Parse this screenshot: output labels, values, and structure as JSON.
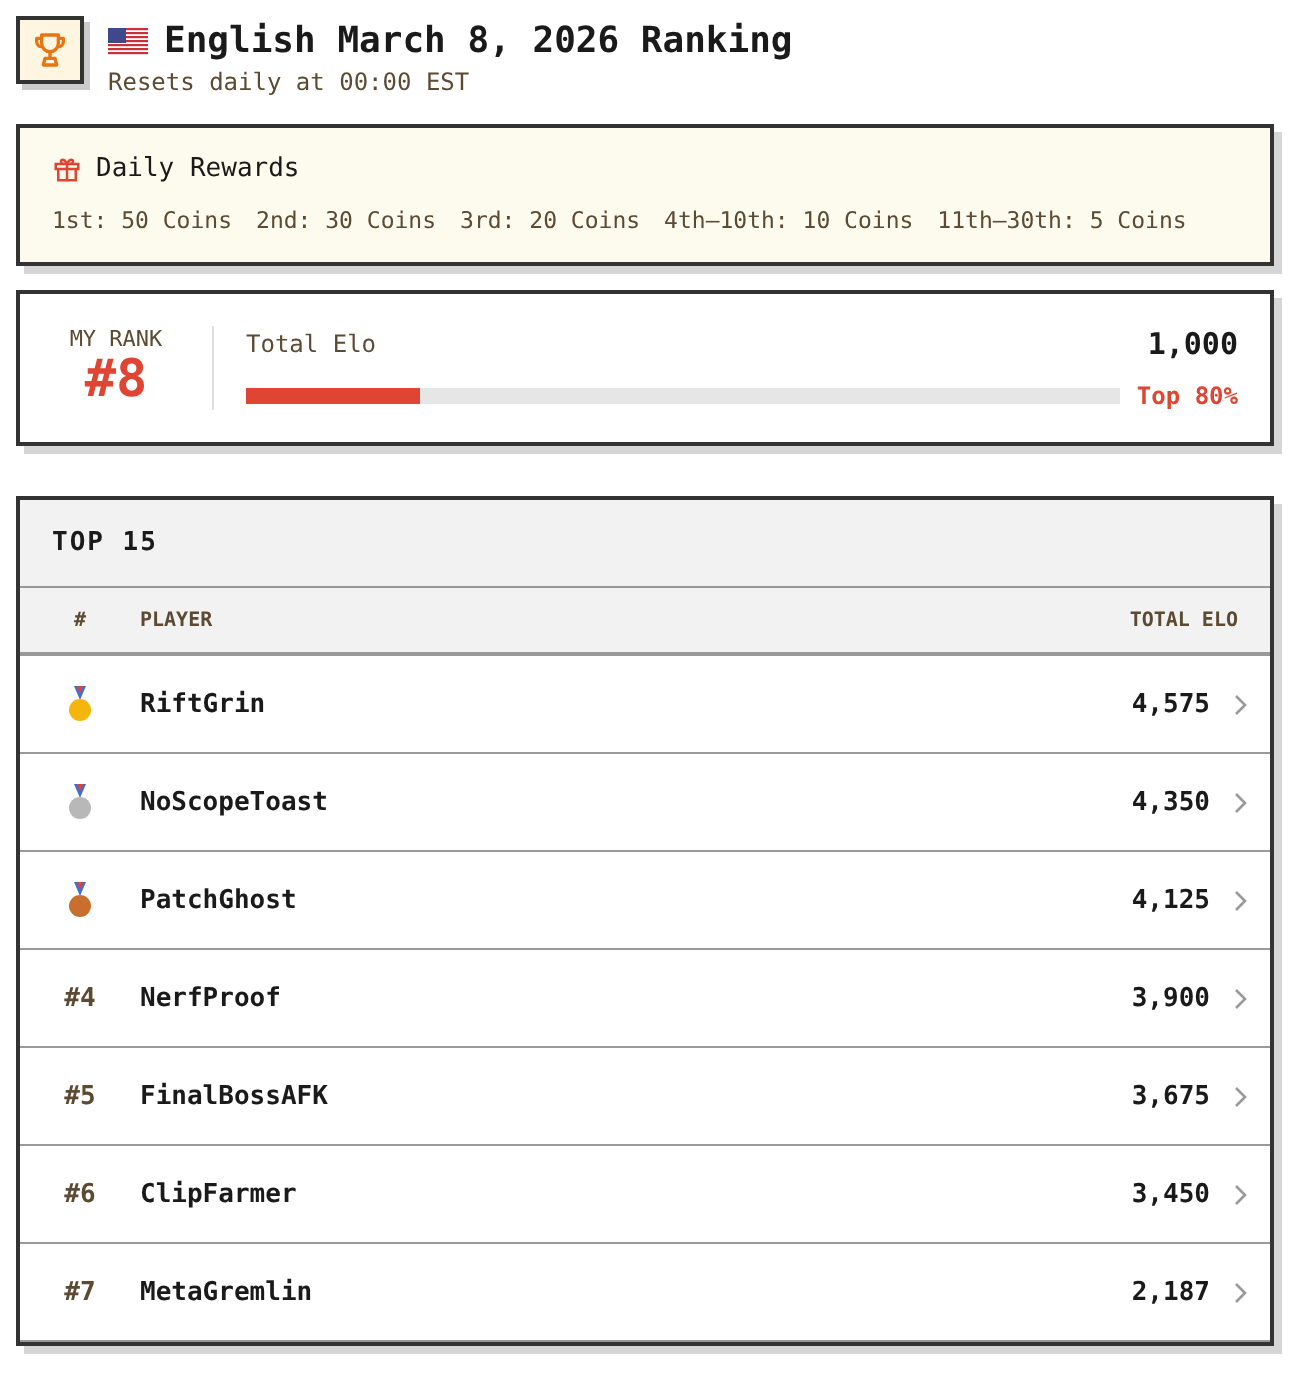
{
  "header": {
    "title": "English March 8, 2026 Ranking",
    "subtitle": "Resets daily at 00:00 EST"
  },
  "rewards": {
    "title": "Daily Rewards",
    "tiers": [
      "1st: 50 Coins",
      "2nd: 30 Coins",
      "3rd: 20 Coins",
      "4th–10th: 10 Coins",
      "11th–30th: 5 Coins"
    ]
  },
  "my_rank": {
    "label": "MY RANK",
    "rank": "#8",
    "metric": "Total Elo",
    "value": "1,000",
    "level": 0.2,
    "percentile": "Top 80%"
  },
  "leaderboard": {
    "title": "TOP 15",
    "columns": [
      "#",
      "PLAYER",
      "TOTAL ELO"
    ],
    "rows": [
      {
        "kind": "medal",
        "color": "#f5b50a",
        "player": "RiftGrin",
        "elo": "4,575"
      },
      {
        "kind": "medal",
        "color": "#b8b8b8",
        "player": "NoScopeToast",
        "elo": "4,350"
      },
      {
        "kind": "medal",
        "color": "#c86f2e",
        "player": "PatchGhost",
        "elo": "4,125"
      },
      {
        "kind": "rank",
        "rank": "#4",
        "player": "NerfProof",
        "elo": "3,900"
      },
      {
        "kind": "rank",
        "rank": "#5",
        "player": "FinalBossAFK",
        "elo": "3,675"
      },
      {
        "kind": "rank",
        "rank": "#6",
        "player": "ClipFarmer",
        "elo": "3,450"
      },
      {
        "kind": "rank",
        "rank": "#7",
        "player": "MetaGremlin",
        "elo": "2,187"
      }
    ]
  }
}
